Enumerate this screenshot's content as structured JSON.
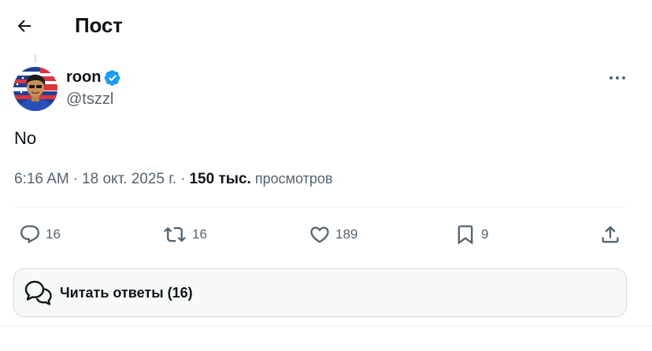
{
  "header": {
    "title": "Пост"
  },
  "post": {
    "author_name": "roon",
    "author_handle": "@tszzl",
    "verified": true,
    "text": "No",
    "time": "6:16 AM",
    "date": "18 окт. 2025 г.",
    "views_count": "150 тыс.",
    "views_label": "просмотров"
  },
  "actions": {
    "replies": "16",
    "reposts": "16",
    "likes": "189",
    "bookmarks": "9"
  },
  "read_replies": {
    "label": "Читать ответы (16)"
  },
  "colors": {
    "text": "#0f1419",
    "secondary": "#536471",
    "verified": "#1d9bf0",
    "border": "#cfd9de",
    "button_bg": "#f7f9f9"
  },
  "icons": [
    "back-arrow-icon",
    "verified-badge-icon",
    "more-icon",
    "reply-icon",
    "repost-icon",
    "like-icon",
    "bookmark-icon",
    "share-icon",
    "chat-bubbles-icon"
  ]
}
